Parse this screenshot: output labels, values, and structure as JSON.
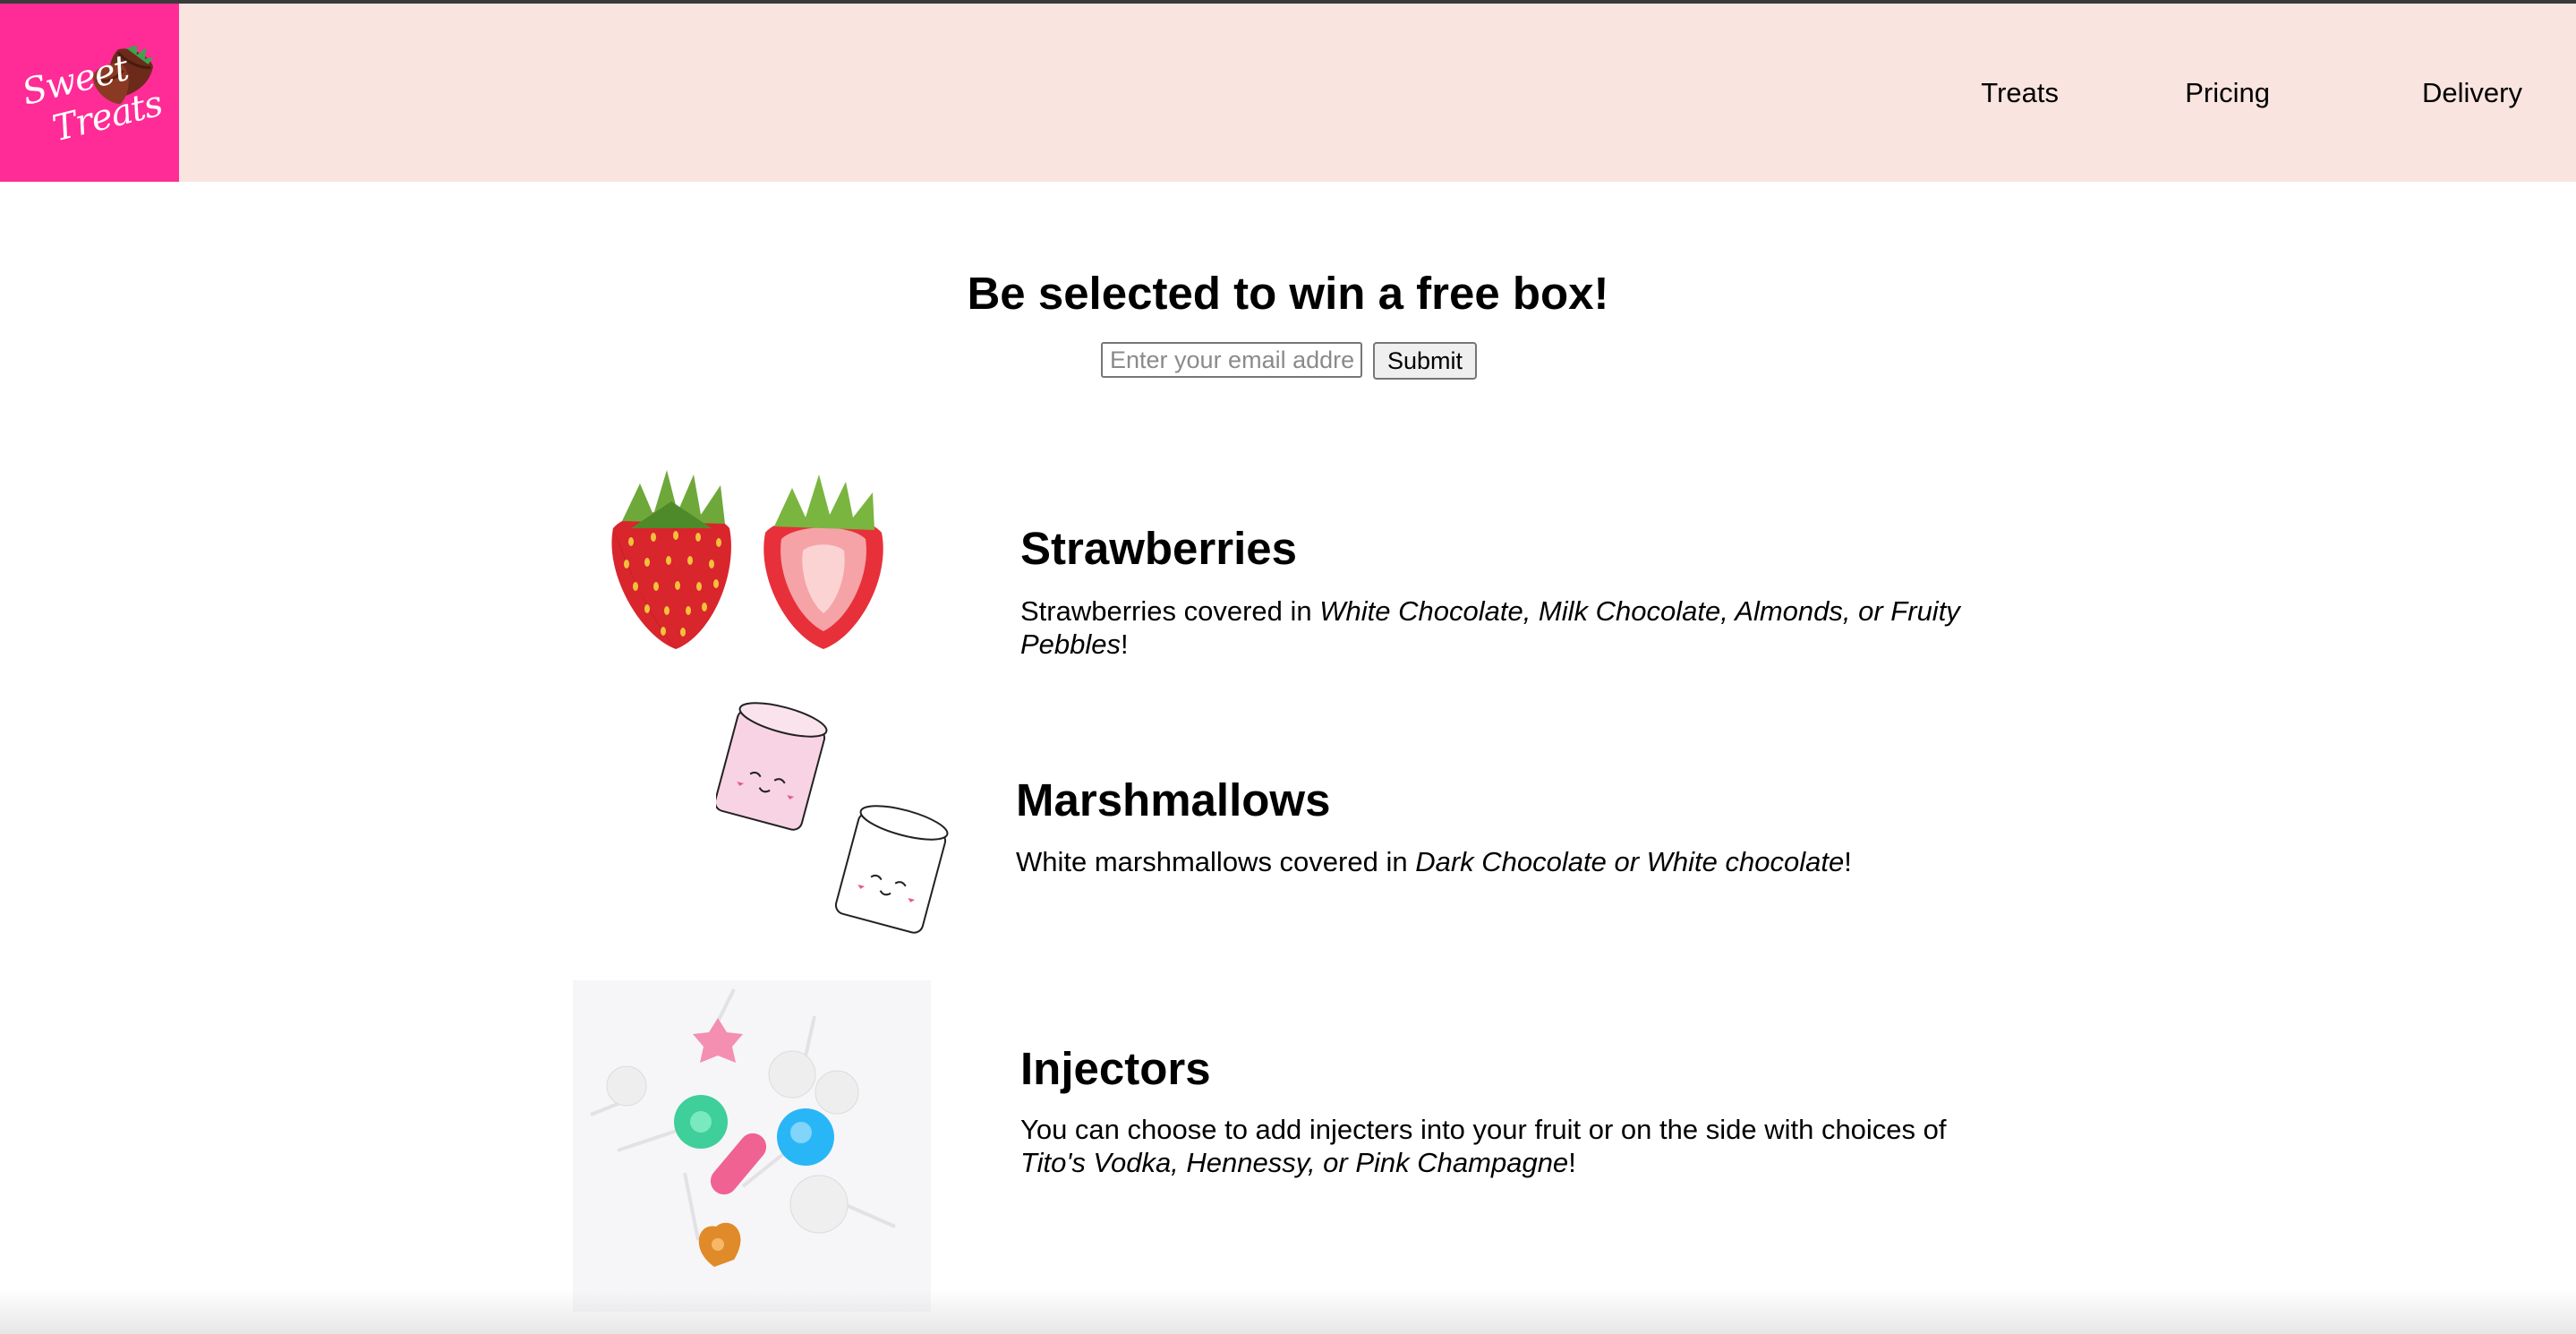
{
  "header": {
    "logo": {
      "line1": "Sweet",
      "line2": "Treats",
      "background": "#ff2b96",
      "icon": "chocolate-strawberry-icon"
    },
    "nav": [
      {
        "label": "Treats"
      },
      {
        "label": "Pricing"
      },
      {
        "label": "Delivery"
      }
    ],
    "background": "#f9e4df"
  },
  "promo": {
    "title": "Be selected to win a free box!",
    "email_placeholder": "Enter your email address",
    "submit_label": "Submit"
  },
  "treats": [
    {
      "name": "Strawberries",
      "image_icon": "strawberries-image",
      "text_before": "Strawberries covered in ",
      "text_emphasis": "White Chocolate, Milk Chocolate, Almonds, or Fruity Pebbles",
      "text_after": "!"
    },
    {
      "name": "Marshmallows",
      "image_icon": "marshmallows-image",
      "text_before": "White marshmallows covered in ",
      "text_emphasis": "Dark Chocolate or White chocolate",
      "text_after": "!"
    },
    {
      "name": "Injectors",
      "image_icon": "injectors-image",
      "text_before": "You can choose to add injecters into your fruit or on the side with choices of ",
      "text_emphasis": "Tito's Vodka, Hennessy, or Pink Champagne",
      "text_after": "!"
    }
  ]
}
